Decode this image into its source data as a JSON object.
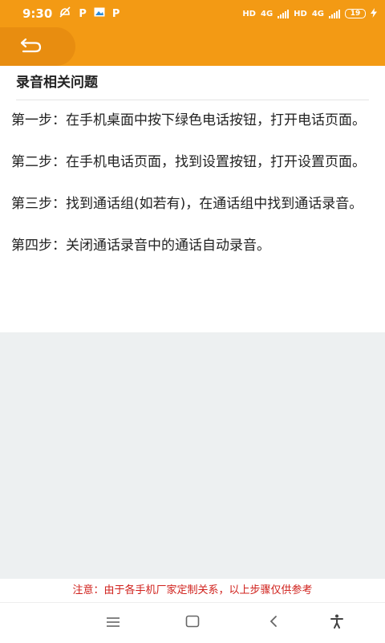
{
  "status_bar": {
    "time": "9:30",
    "icons": [
      "notification-off-icon",
      "p-icon",
      "image-icon",
      "p-icon"
    ],
    "network_labels": [
      "HD",
      "4G",
      "HD",
      "4G"
    ],
    "battery": "19"
  },
  "header": {
    "back_icon": "back-arrow-icon",
    "color": "#f39a14"
  },
  "section": {
    "title": "录音相关问题"
  },
  "steps": [
    "第一步：在手机桌面中按下绿色电话按钮，打开电话页面。",
    "第二步：在手机电话页面，找到设置按钮，打开设置页面。",
    "第三步：找到通话组(如若有)，在通话组中找到通话录音。",
    "第四步：关闭通话录音中的通话自动录音。"
  ],
  "notice": "注意：由于各手机厂家定制关系，以上步骤仅供参考",
  "colors": {
    "accent": "#f39a14",
    "notice": "#d0211c"
  },
  "nav_bar": {
    "icons": [
      "menu-icon",
      "home-icon",
      "back-icon",
      "accessibility-icon"
    ]
  }
}
